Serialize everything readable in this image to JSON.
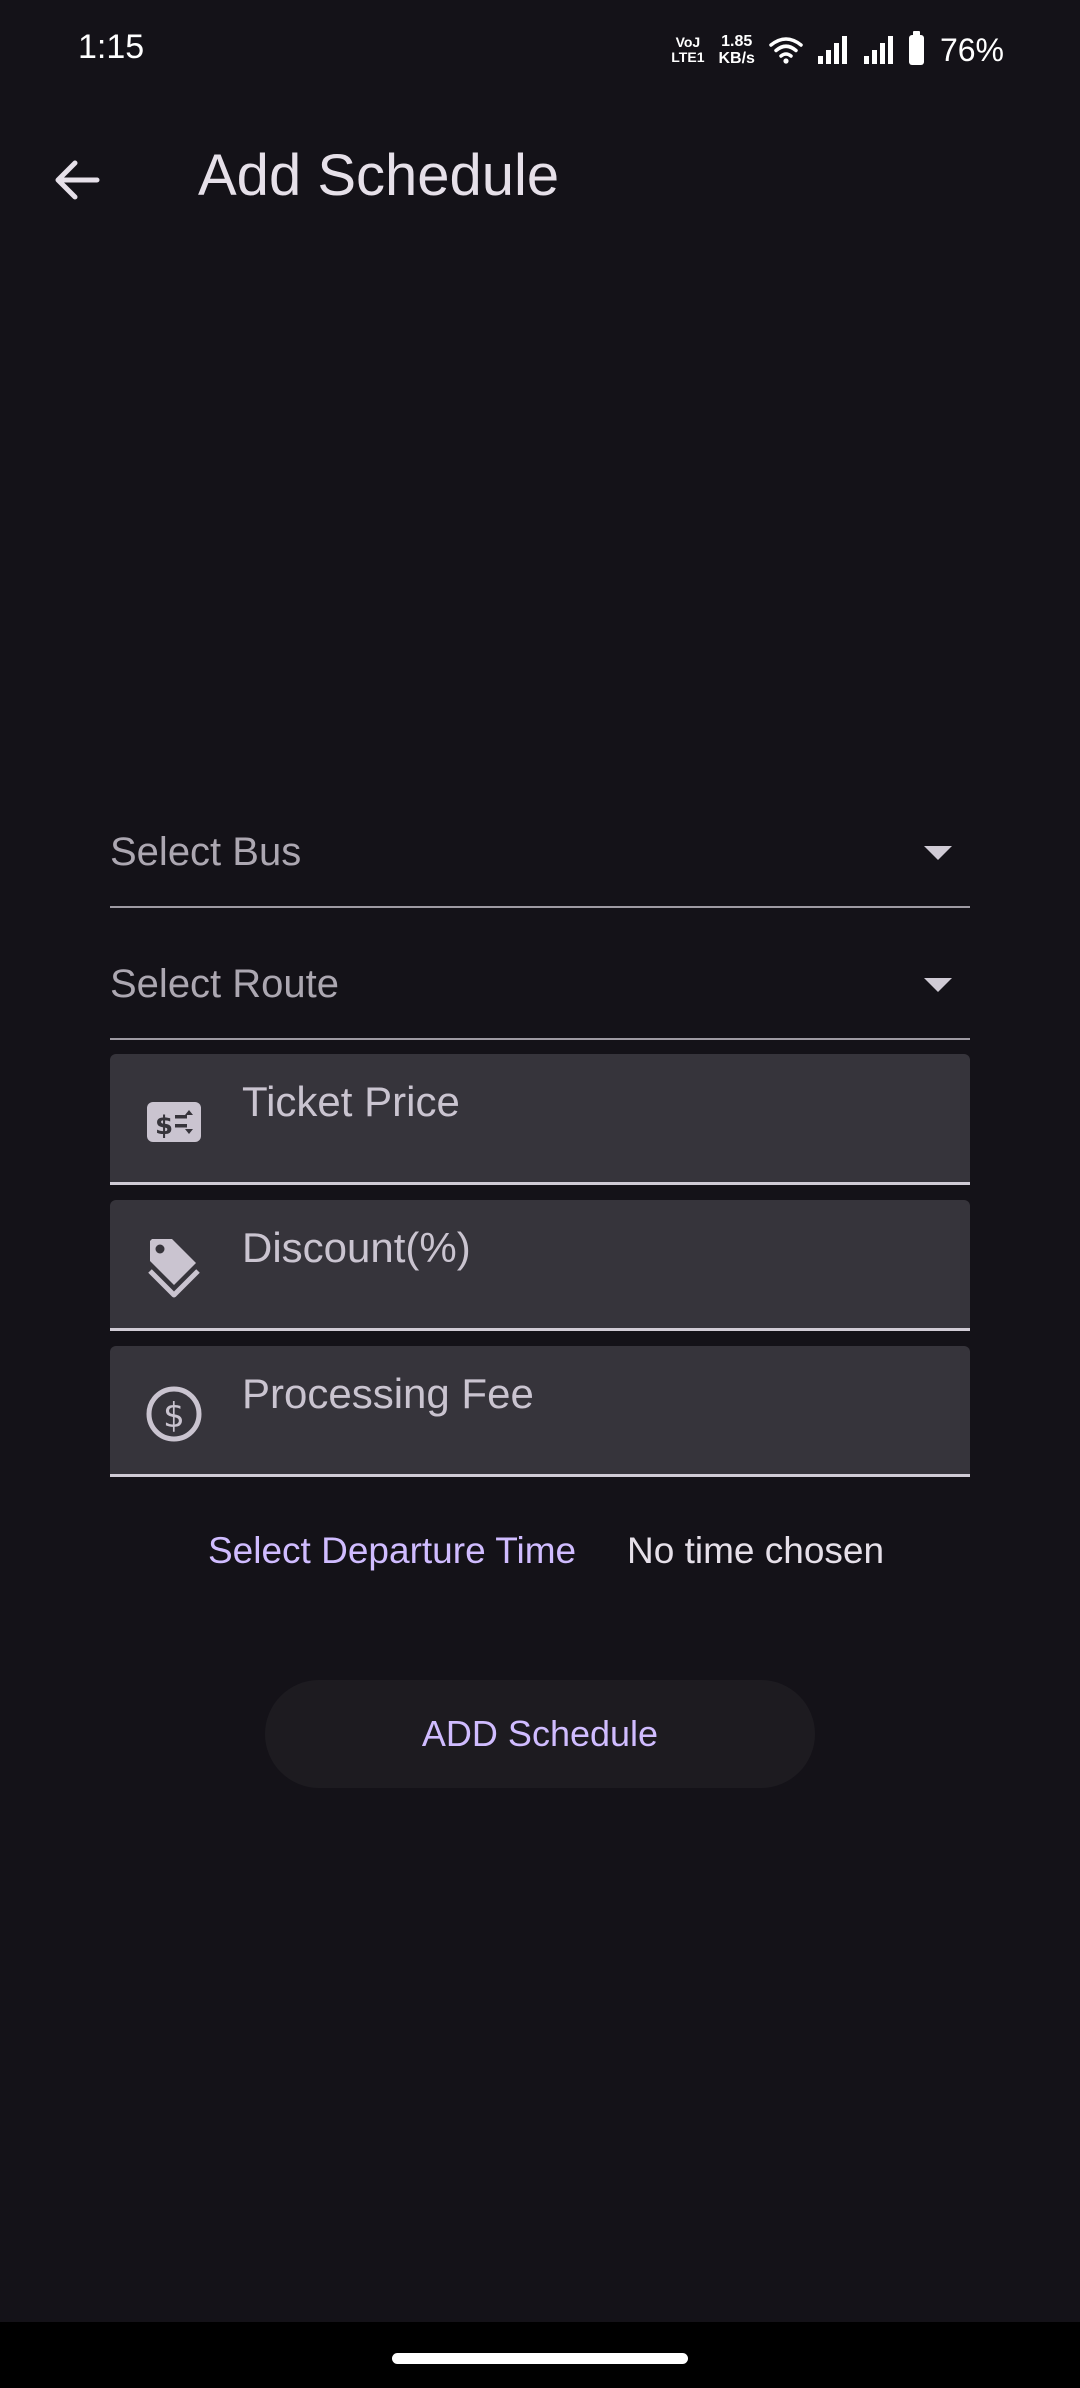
{
  "status_bar": {
    "time": "1:15",
    "volte_line1": "VoJ",
    "volte_line2": "LTE1",
    "net_speed_value": "1.85",
    "net_speed_unit": "KB/s",
    "battery_percent": "76%",
    "icons": [
      "wifi-icon",
      "signal-icon",
      "signal-icon",
      "battery-icon"
    ]
  },
  "app_bar": {
    "back_icon": "arrow-left-icon",
    "title": "Add Schedule"
  },
  "form": {
    "bus_dropdown": {
      "label": "Select Bus",
      "icon": "dropdown-arrow-icon"
    },
    "route_dropdown": {
      "label": "Select Route",
      "icon": "dropdown-arrow-icon"
    },
    "ticket_price": {
      "placeholder": "Ticket Price",
      "icon": "price-tag-icon"
    },
    "discount": {
      "placeholder": "Discount(%)",
      "icon": "discount-tag-icon"
    },
    "processing_fee": {
      "placeholder": "Processing Fee",
      "icon": "dollar-circle-icon"
    },
    "departure_time": {
      "button_label": "Select Departure Time",
      "value": "No time chosen"
    },
    "submit_label": "ADD Schedule"
  },
  "colors": {
    "background": "#141218",
    "accent": "#d0bcff",
    "field_fill": "#36343b"
  }
}
